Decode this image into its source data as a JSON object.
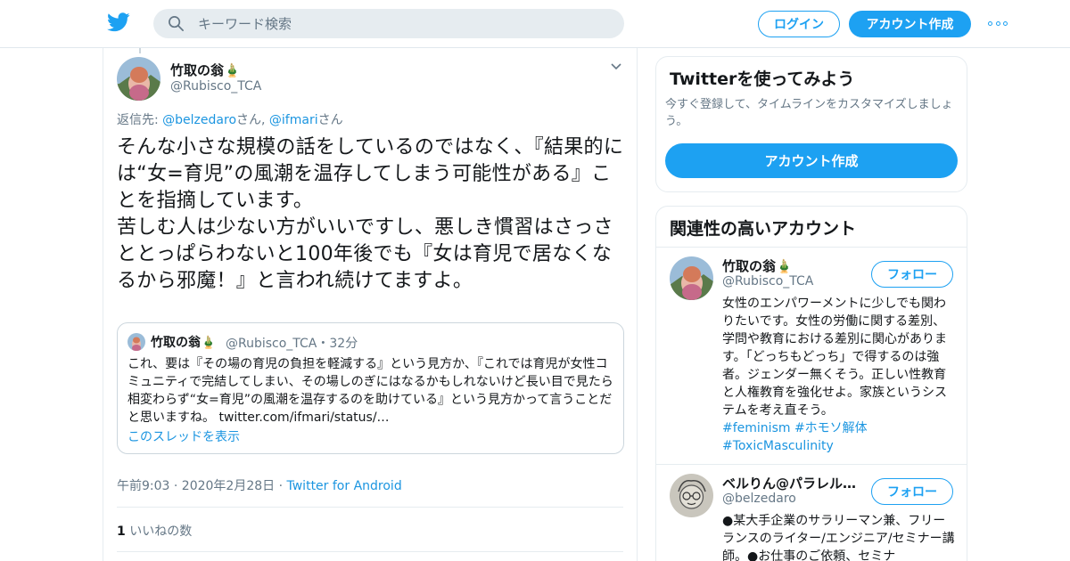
{
  "colors": {
    "accent": "#1da1f2",
    "link": "#1b95e0",
    "muted": "#657786",
    "text": "#14171a"
  },
  "header": {
    "logo": "twitter-bird-icon",
    "search_placeholder": "キーワード検索",
    "login_label": "ログイン",
    "signup_label": "アカウント作成",
    "more": "more-dots-icon"
  },
  "tweet": {
    "author_name": "竹取の翁🎍",
    "author_handle": "@Rubisco_TCA",
    "reply_prefix": "返信先: ",
    "reply_user1": "@belzedaro",
    "reply_san1": "さん",
    "reply_sep": ", ",
    "reply_user2": "@ifmari",
    "reply_san2": "さん",
    "text": "そんな小さな規模の話をしているのではなく、『結果的には“女=育児”の風潮を温存してしまう可能性がある』ことを指摘しています。\n苦しむ人は少ない方がいいですし、悪しき慣習はさっさととっぱらわないと100年後でも『女は育児で居なくなるから邪魔！』と言われ続けてますよ。",
    "quote": {
      "name": "竹取の翁🎍",
      "handle": "@Rubisco_TCA・32分",
      "text": "これ、要は『その場の育児の負担を軽減する』という見方か、『これでは育児が女性コミュニティで完結してしまい、その場しのぎにはなるかもしれないけど長い目で見たら相変わらず“女=育児”の風潮を温存するのを助けている』という見方かって言うことだと思いますね。 twitter.com/ifmari/status/…",
      "thread_link": "このスレッドを表示"
    },
    "meta_time": "午前9:03 · 2020年2月28日 · ",
    "meta_source": "Twitter for Android",
    "likes_count": "1",
    "likes_label": " いいねの数"
  },
  "sidebar": {
    "signup_card": {
      "title": "Twitterを使ってみよう",
      "subtitle": "今すぐ登録して、タイムラインをカスタマイズしましょう。",
      "button": "アカウント作成"
    },
    "related": {
      "title": "関連性の高いアカウント",
      "accounts": [
        {
          "name": "竹取の翁🎍",
          "handle": "@Rubisco_TCA",
          "follow": "フォロー",
          "bio": "女性のエンパワーメントに少しでも関わりたいです。女性の労働に関する差別、学問や教育における差別に関心があります。「どっちもどっち」で得するのは強者。ジェンダー無くそう。正しい性教育と人権教育を強化せよ。家族というシステムを考え直そう。",
          "tags": "#feminism #ホモソ解体\n#ToxicMasculinity"
        },
        {
          "name": "ベルりん@パラレルワーカー",
          "handle": "@belzedaro",
          "follow": "フォロー",
          "bio": "●某大手企業のサラリーマン兼、フリーランスのライター/エンジニア/セミナー講師。●お仕事のご依頼、セミナ"
        }
      ]
    }
  }
}
